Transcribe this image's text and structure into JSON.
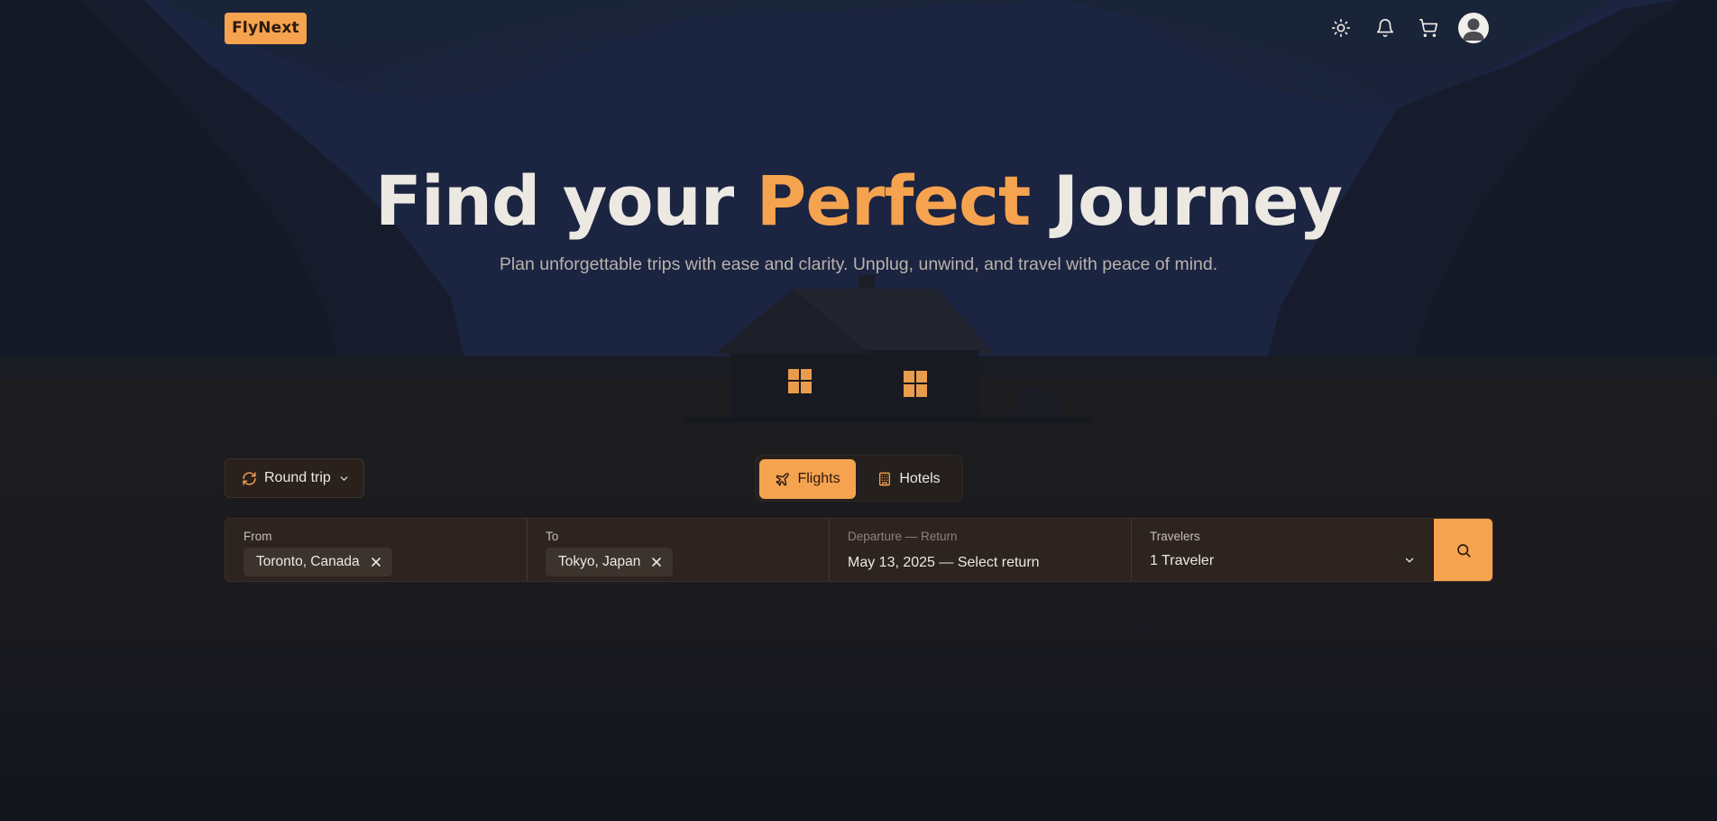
{
  "brand": {
    "logo": "FlyNext",
    "accent": "#f6a350"
  },
  "header": {
    "icons": [
      "sun-icon",
      "bell-icon",
      "cart-icon",
      "user-avatar"
    ]
  },
  "hero": {
    "title_part1": "Find your ",
    "title_accent": "Perfect",
    "title_part2": " Journey",
    "subtitle": "Plan unforgettable trips with ease and clarity. Unplug, unwind, and travel with peace of mind."
  },
  "controls": {
    "trip_type": "Round trip",
    "modes": [
      {
        "label": "Flights",
        "active": true
      },
      {
        "label": "Hotels",
        "active": false
      }
    ]
  },
  "search": {
    "from": {
      "label": "From",
      "value": "Toronto, Canada"
    },
    "to": {
      "label": "To",
      "value": "Tokyo, Japan"
    },
    "dates": {
      "label": "Departure — Return",
      "value": "May 13, 2025 — Select return"
    },
    "travelers": {
      "label": "Travelers",
      "value": "1 Traveler"
    }
  }
}
